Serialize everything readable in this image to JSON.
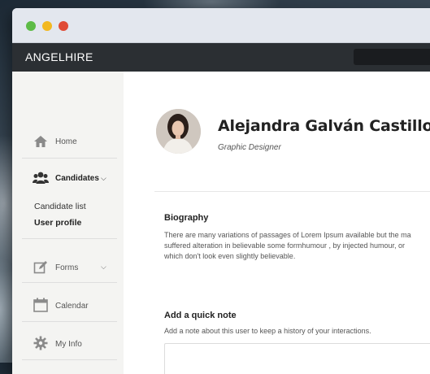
{
  "app": {
    "brand": "ANGELHIRE"
  },
  "sidebar": {
    "items": [
      {
        "label": "Home",
        "icon": "home-icon"
      },
      {
        "label": "Candidates",
        "icon": "users-icon"
      },
      {
        "label": "Forms",
        "icon": "edit-icon"
      },
      {
        "label": "Calendar",
        "icon": "calendar-icon"
      },
      {
        "label": "My Info",
        "icon": "gear-icon"
      }
    ],
    "subitems": [
      "Candidate list",
      "User profile"
    ]
  },
  "profile": {
    "name": "Alejandra Galván Castillo",
    "role": "Graphic Designer"
  },
  "biography": {
    "title": "Biography",
    "lines": [
      "There are many variations of passages of Lorem Ipsum available but the ma",
      "suffered alteration in believable some formhumour , by injected humour, or",
      "which don't look even slightly believable."
    ]
  },
  "quick_note": {
    "title": "Add a quick note",
    "subtitle": "Add a note about this user to keep a history of your interactions."
  },
  "colors": {
    "appbar": "#2b2f33",
    "sidebar": "#f4f4f2",
    "traffic_green": "#5dbb46",
    "traffic_yellow": "#f2b820",
    "traffic_red": "#e04b35"
  }
}
